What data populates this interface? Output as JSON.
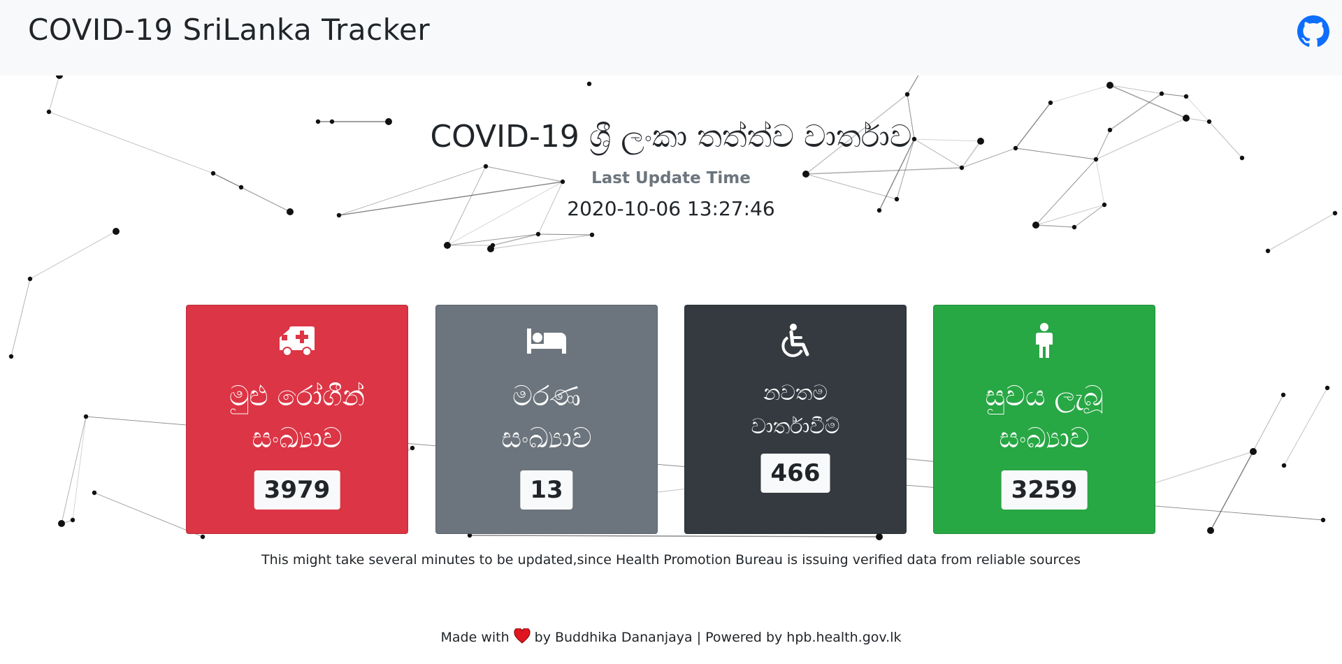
{
  "navbar": {
    "brand": "COVID-19 SriLanka Tracker",
    "github_icon": "github-icon"
  },
  "header": {
    "title": "COVID-19 ශ්‍රී ලංකා තත්ත්ව වාර්තාව",
    "update_label": "Last Update Time",
    "update_time": "2020-10-06 13:27:46"
  },
  "cards": [
    {
      "icon": "ambulance-icon",
      "line1": "මුළු රෝගීන්",
      "line2": "සංඛ්‍යාව",
      "count": "3979",
      "color": "#dc3545"
    },
    {
      "icon": "bed-icon",
      "line1": "මරණ",
      "line2": "සංඛ්‍යාව",
      "count": "13",
      "color": "#6c757d"
    },
    {
      "icon": "wheelchair-icon",
      "line1": "නවතම",
      "line2": "වාර්තාවීම්",
      "count": "466",
      "color": "#343a40"
    },
    {
      "icon": "male-icon",
      "line1": "සුවය ලැබූ",
      "line2": "සංඛ්‍යාව",
      "count": "3259",
      "color": "#28a745"
    }
  ],
  "note": "This might take several minutes to be updated,since Health Promotion Bureau is issuing verified data from reliable sources",
  "footer": {
    "made_with": "Made with",
    "by": "by Buddhika Dananjaya | Powered by hpb.health.gov.lk"
  }
}
